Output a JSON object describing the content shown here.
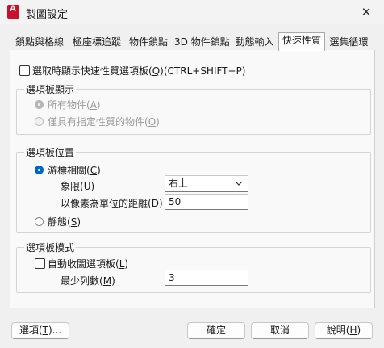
{
  "window": {
    "title": "製圖設定",
    "close": "✕"
  },
  "tabs": [
    "鎖點與格線",
    "極座標追蹤",
    "物件鎖點",
    "3D 物件鎖點",
    "動態輸入",
    "快速性質",
    "選集循環"
  ],
  "show_on_select": {
    "text": "選取時顯示快速性質選項板",
    "key": "Q",
    "shortcut": "(CTRL+SHIFT+P)"
  },
  "palette_display": {
    "legend": "選項板顯示",
    "all_objects": {
      "text": "所有物件",
      "key": "A"
    },
    "specified_only": {
      "text": "僅具有指定性質的物件",
      "key": "O"
    }
  },
  "palette_location": {
    "legend": "選項板位置",
    "cursor_dependent": {
      "text": "游標相關",
      "key": "C"
    },
    "quadrant": {
      "label": "象限",
      "key": "U",
      "value": "右上"
    },
    "distance": {
      "label": "以像素為單位的距離",
      "key": "D",
      "value": "50"
    },
    "static": {
      "text": "靜態",
      "key": "S"
    }
  },
  "palette_behavior": {
    "legend": "選項板模式",
    "auto_collapse": {
      "text": "自動收闔選項板",
      "key": "L"
    },
    "min_rows": {
      "label": "最少列數",
      "key": "M",
      "value": "3"
    }
  },
  "buttons": {
    "options": {
      "text": "選項",
      "key": "T",
      "suffix": "..."
    },
    "ok": "確定",
    "cancel": "取消",
    "help": {
      "text": "說明",
      "key": "H"
    }
  }
}
